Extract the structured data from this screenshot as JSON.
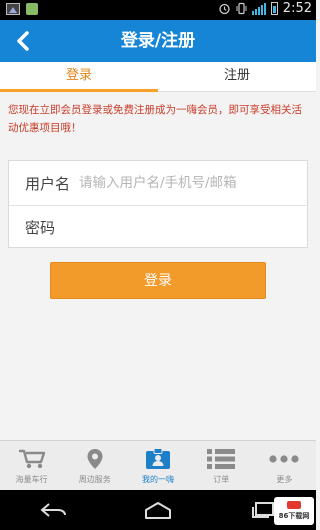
{
  "status_bar": {
    "time": "2:52",
    "left_icons": [
      "image-notification-icon",
      "shopping-bag-icon"
    ],
    "right_icons": [
      "alarm-icon",
      "vibrate-icon",
      "signal-icon",
      "battery-icon"
    ]
  },
  "header": {
    "title": "登录/注册",
    "back_icon": "back-arrow-icon"
  },
  "tabs": [
    {
      "label": "登录",
      "active": true
    },
    {
      "label": "注册",
      "active": false
    }
  ],
  "notice": "您现在立即会员登录或免费注册成为一嗨会员，即可享受相关活动优惠项目哦！",
  "form": {
    "username_label": "用户名",
    "username_placeholder": "请输入用户名/手机号/邮箱",
    "username_value": "",
    "password_label": "密码",
    "password_placeholder": "",
    "password_value": ""
  },
  "login_button": "登录",
  "bottom_nav": [
    {
      "label": "海量车行",
      "icon": "cart-icon",
      "active": false
    },
    {
      "label": "周边服务",
      "icon": "location-pin-icon",
      "active": false
    },
    {
      "label": "我的一嗨",
      "icon": "my-account-icon",
      "active": true
    },
    {
      "label": "订单",
      "icon": "list-icon",
      "active": false
    },
    {
      "label": "更多",
      "icon": "more-dots-icon",
      "active": false
    }
  ],
  "system_nav": [
    "back-key-icon",
    "home-key-icon",
    "recent-apps-key-icon"
  ],
  "watermark": {
    "text": "86下载网"
  },
  "colors": {
    "header_blue": "#1685d6",
    "accent_orange": "#f39b2a",
    "notice_red": "#c83c2a",
    "active_nav_blue": "#1c7fc8"
  }
}
